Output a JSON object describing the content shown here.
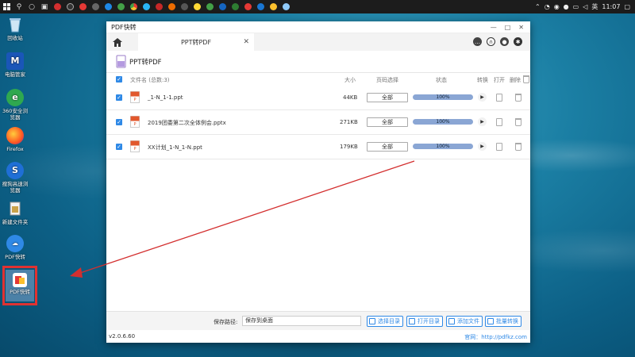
{
  "taskbar": {
    "tray_lang": "英",
    "time": "11:07"
  },
  "desktop_icons": [
    {
      "label": "回收站",
      "icon": "recycle-bin-icon"
    },
    {
      "label": "电脑管家",
      "icon": "pc-manager-icon"
    },
    {
      "label": "360安全浏览器",
      "icon": "360-browser-icon"
    },
    {
      "label": "Firefox",
      "icon": "firefox-icon"
    },
    {
      "label": "搜狗高速浏览器",
      "icon": "sogou-browser-icon"
    },
    {
      "label": "新建文件夹",
      "icon": "folder-icon"
    },
    {
      "label": "PDF快转",
      "icon": "pdf-cloud-icon"
    },
    {
      "label": "PDF快转",
      "icon": "pdf-app-icon"
    }
  ],
  "window": {
    "title": "PDF快转",
    "tab_label": "PPT转PDF",
    "section_title": "PPT转PDF",
    "columns": {
      "filename": "文件名 (总数:3)",
      "size": "大小",
      "pages": "页码选择",
      "status": "状态",
      "convert": "转换",
      "open": "打开",
      "delete": "删除"
    },
    "files": [
      {
        "name": "_1-N_1-1.ppt",
        "size": "44KB",
        "pages": "全部",
        "progress": "100%"
      },
      {
        "name": "2019团委第二次全体例会.pptx",
        "size": "271KB",
        "pages": "全部",
        "progress": "100%"
      },
      {
        "name": "XX计划_1-N_1-N.ppt",
        "size": "179KB",
        "pages": "全部",
        "progress": "100%"
      }
    ],
    "footer": {
      "save_path_label": "保存路径:",
      "save_path_value": "保存到桌面",
      "choose_dir": "选择目录",
      "open_dir": "打开目录",
      "add_file": "添加文件",
      "batch_convert": "批量转换"
    },
    "version": "v2.0.6.60",
    "website": "官网：http://pdfkz.com"
  },
  "colors": {
    "accent": "#2f89e6",
    "progress": "#8aa6d4",
    "highlight": "#e03232"
  }
}
